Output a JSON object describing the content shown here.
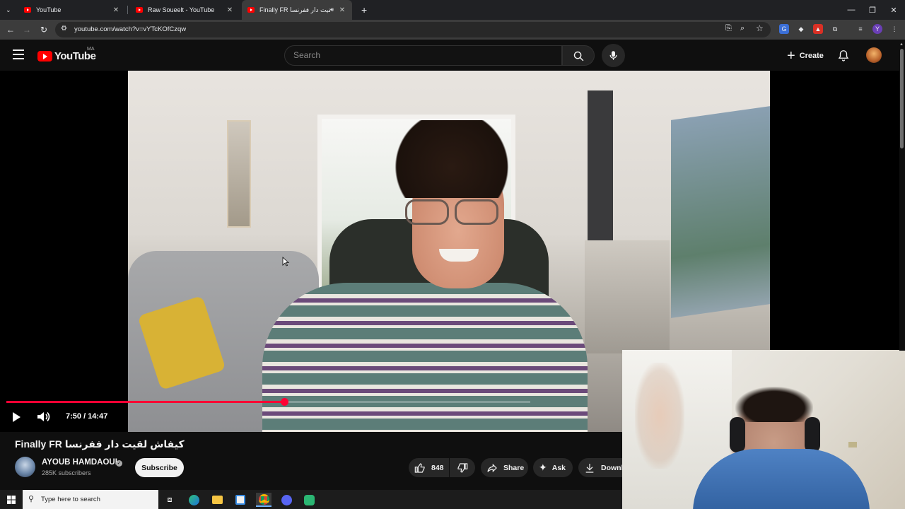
{
  "browser": {
    "tabs": [
      {
        "title": "YouTube",
        "active": false
      },
      {
        "title": "Raw Soueelt - YouTube",
        "active": false
      },
      {
        "title": "Finally FR كيفاش لقيت دار ففرنسا",
        "active": true
      }
    ],
    "new_tab_label": "+",
    "url": "youtube.com/watch?v=vYTcKOfCzqw"
  },
  "youtube": {
    "logo_text": "YouTube",
    "region": "MA",
    "search_placeholder": "Search",
    "create_label": "Create"
  },
  "player": {
    "current_time": "7:50",
    "duration": "14:47",
    "time_display": "7:50 / 14:47",
    "progress_fraction": 0.53,
    "playing": false
  },
  "video": {
    "title": "Finally FR كيفاش لقيت دار ففرنسا",
    "channel_name": "AYOUB HAMDAOUI",
    "verified_mark": "✓",
    "subscribers": "285K subscribers",
    "subscribe_label": "Subscribe",
    "likes": "848",
    "share_label": "Share",
    "ask_label": "Ask",
    "download_label": "Downlo"
  },
  "taskbar": {
    "search_placeholder": "Type here to search"
  },
  "colors": {
    "accent": "#ff0033",
    "background": "#0f0f0f",
    "chrome_tabs": "#202124",
    "chrome_toolbar": "#3c3c3c"
  }
}
